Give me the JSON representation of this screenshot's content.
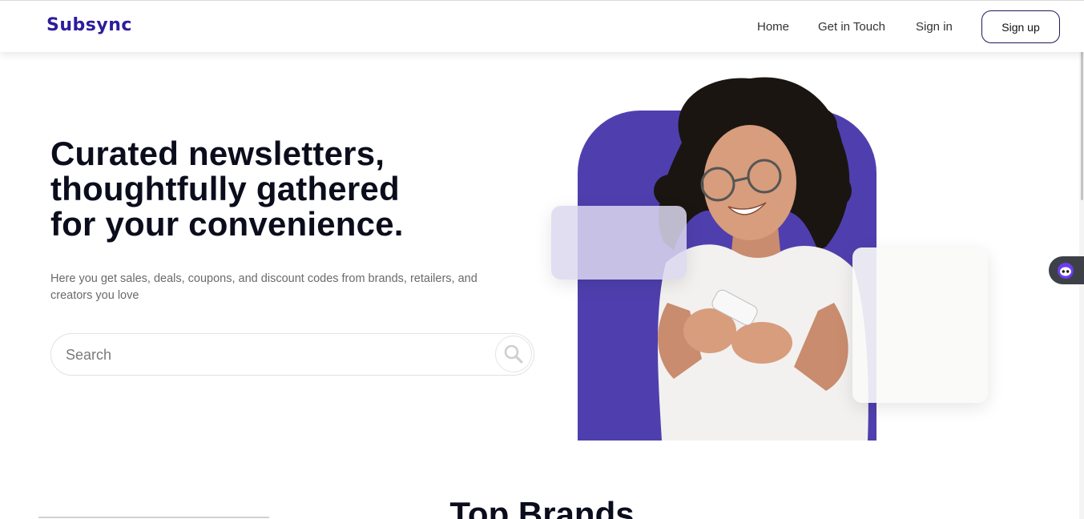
{
  "brand": {
    "logo_text": "Subsync",
    "accent_color": "#2b1d9c"
  },
  "nav": {
    "links": [
      "Home",
      "Get in Touch",
      "Sign in"
    ],
    "signup_label": "Sign up"
  },
  "hero": {
    "title_lines": [
      "Curated newsletters,",
      "thoughtfully gathered",
      "for your convenience."
    ],
    "subtitle": "Here you get sales, deals, coupons, and discount codes from brands, retailers, and creators you love",
    "search_placeholder": "Search",
    "art_color": "#4f3fae",
    "photo_icon": "woman-with-phone-illustration"
  },
  "assistant": {
    "icon": "chatbot-face-icon"
  },
  "section": {
    "title": "Top Brands"
  }
}
